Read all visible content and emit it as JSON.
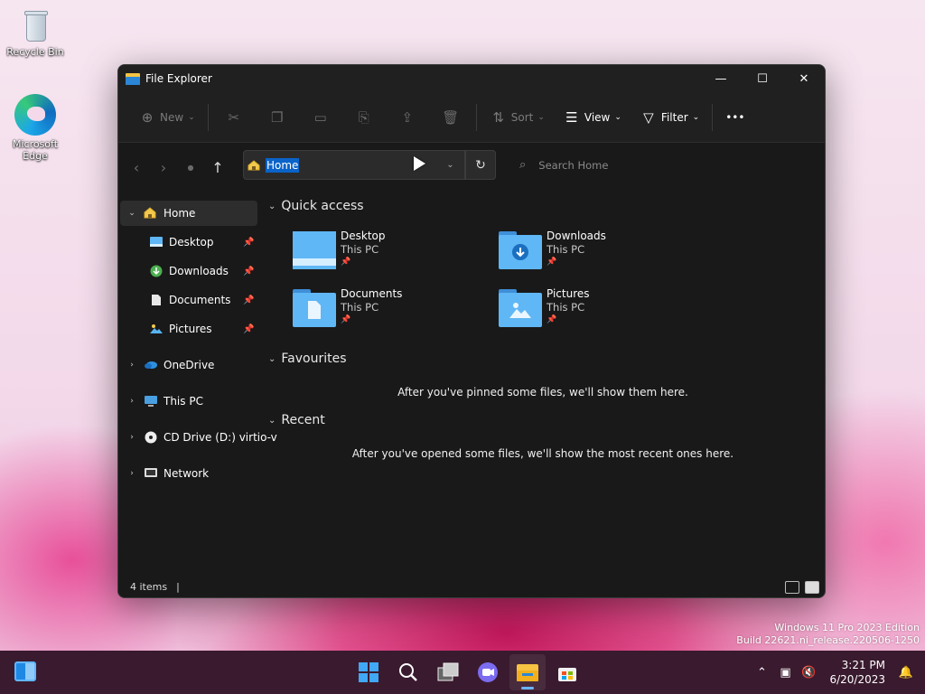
{
  "desktop": {
    "icons": [
      {
        "label": "Recycle Bin",
        "icon": "recycle-bin-icon"
      },
      {
        "label": "Microsoft Edge",
        "icon": "edge-icon"
      }
    ],
    "watermark": {
      "line1": "Windows 11 Pro 2023 Edition",
      "line2": "Build 22621.ni_release.220506-1250"
    }
  },
  "window": {
    "title": "File Explorer",
    "controls": {
      "minimize": "—",
      "maximize": "☐",
      "close": "✕"
    },
    "toolbar": {
      "new_label": "New",
      "sort_label": "Sort",
      "view_label": "View",
      "filter_label": "Filter",
      "more_label": "•••"
    },
    "address": {
      "path": "Home",
      "search_placeholder": "Search Home"
    },
    "nav_pane": {
      "home": "Home",
      "pinned": [
        {
          "label": "Desktop"
        },
        {
          "label": "Downloads"
        },
        {
          "label": "Documents"
        },
        {
          "label": "Pictures"
        }
      ],
      "onedrive": "OneDrive",
      "thispc": "This PC",
      "cddrive": "CD Drive (D:) virtio-v",
      "network": "Network"
    },
    "content": {
      "quick_access_title": "Quick access",
      "quick_access": [
        {
          "name": "Desktop",
          "location": "This PC",
          "icon": "desktop-folder-icon"
        },
        {
          "name": "Downloads",
          "location": "This PC",
          "icon": "downloads-folder-icon"
        },
        {
          "name": "Documents",
          "location": "This PC",
          "icon": "documents-folder-icon"
        },
        {
          "name": "Pictures",
          "location": "This PC",
          "icon": "pictures-folder-icon"
        }
      ],
      "favourites_title": "Favourites",
      "favourites_empty": "After you've pinned some files, we'll show them here.",
      "recent_title": "Recent",
      "recent_empty": "After you've opened some files, we'll show the most recent ones here."
    },
    "status": {
      "items": "4 items",
      "cursor": "|"
    }
  },
  "taskbar": {
    "time": "3:21 PM",
    "date": "6/20/2023",
    "apps": [
      "start-icon",
      "search-icon",
      "task-view-icon",
      "chat-icon",
      "file-explorer-icon",
      "store-icon"
    ]
  }
}
